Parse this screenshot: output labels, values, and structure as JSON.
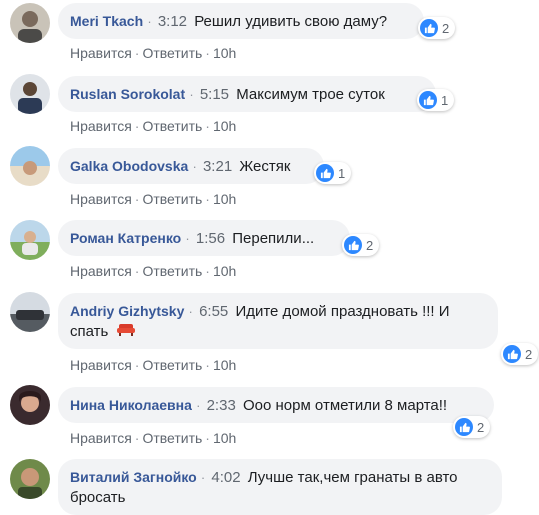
{
  "colors": {
    "author": "#385898",
    "bubble": "#f2f3f5",
    "like": "#2d88ff",
    "meta": "#606770"
  },
  "actions": {
    "like": "Нравится",
    "reply": "Ответить",
    "separator": "·",
    "age": "10h"
  },
  "comments": [
    {
      "author": "Meri Tkach",
      "time": "3:12",
      "text": "Решил удивить свою даму?",
      "reactions": "2"
    },
    {
      "author": "Ruslan Sorokolat",
      "time": "5:15",
      "text": "Максимум трое суток",
      "reactions": "1"
    },
    {
      "author": "Galka Obodovska",
      "time": "3:21",
      "text": "Жестяк",
      "reactions": "1"
    },
    {
      "author": "Роман Катренко",
      "time": "1:56",
      "text": "Перепили...",
      "reactions": "2"
    },
    {
      "author": "Andriy Gizhytsky",
      "time": "6:55",
      "text": "Идите домой праздновать !!! И",
      "text2": "спать",
      "reactions": "2"
    },
    {
      "author": "Нина Николаевна",
      "time": "2:33",
      "text": "Ооо норм отметили 8 марта!!",
      "reactions": "2"
    },
    {
      "author": "Виталий Загнойко",
      "time": "4:02",
      "text": "Лучше так,чем гранаты в авто",
      "text2": "бросать"
    }
  ]
}
